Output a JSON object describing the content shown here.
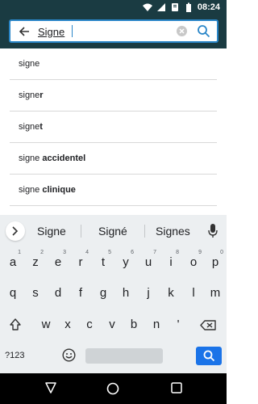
{
  "status_bar": {
    "time": "08:24",
    "icons": [
      "wifi-icon",
      "signal-icon",
      "notification-icon",
      "battery-icon"
    ]
  },
  "search": {
    "value": "Signe",
    "back_icon": "arrow-left-icon",
    "clear_icon": "clear-icon",
    "search_icon": "search-icon"
  },
  "suggestions": [
    {
      "prefix": "signe",
      "rest": ""
    },
    {
      "prefix": "signe",
      "rest": "r"
    },
    {
      "prefix": "signe",
      "rest": "t"
    },
    {
      "prefix": "signe ",
      "rest": "accidentel"
    },
    {
      "prefix": "signe ",
      "rest": "clinique"
    }
  ],
  "keyboard": {
    "candidates": [
      "Signe",
      "Signé",
      "Signes"
    ],
    "row1": [
      {
        "k": "a",
        "h": "1"
      },
      {
        "k": "z",
        "h": "2"
      },
      {
        "k": "e",
        "h": "3"
      },
      {
        "k": "r",
        "h": "4"
      },
      {
        "k": "t",
        "h": "5"
      },
      {
        "k": "y",
        "h": "6"
      },
      {
        "k": "u",
        "h": "7"
      },
      {
        "k": "i",
        "h": "8"
      },
      {
        "k": "o",
        "h": "9"
      },
      {
        "k": "p",
        "h": "0"
      }
    ],
    "row2": [
      "q",
      "s",
      "d",
      "f",
      "g",
      "h",
      "j",
      "k",
      "l",
      "m"
    ],
    "row3": [
      "w",
      "x",
      "c",
      "v",
      "b",
      "n",
      "'"
    ],
    "symbols_label": "?123",
    "colors": {
      "enter": "#1a73e8",
      "bar": "#1a3b42",
      "focus": "#2a86c8"
    }
  },
  "nav": {
    "back": "nav-back-icon",
    "home": "nav-home-icon",
    "recents": "nav-recents-icon"
  }
}
